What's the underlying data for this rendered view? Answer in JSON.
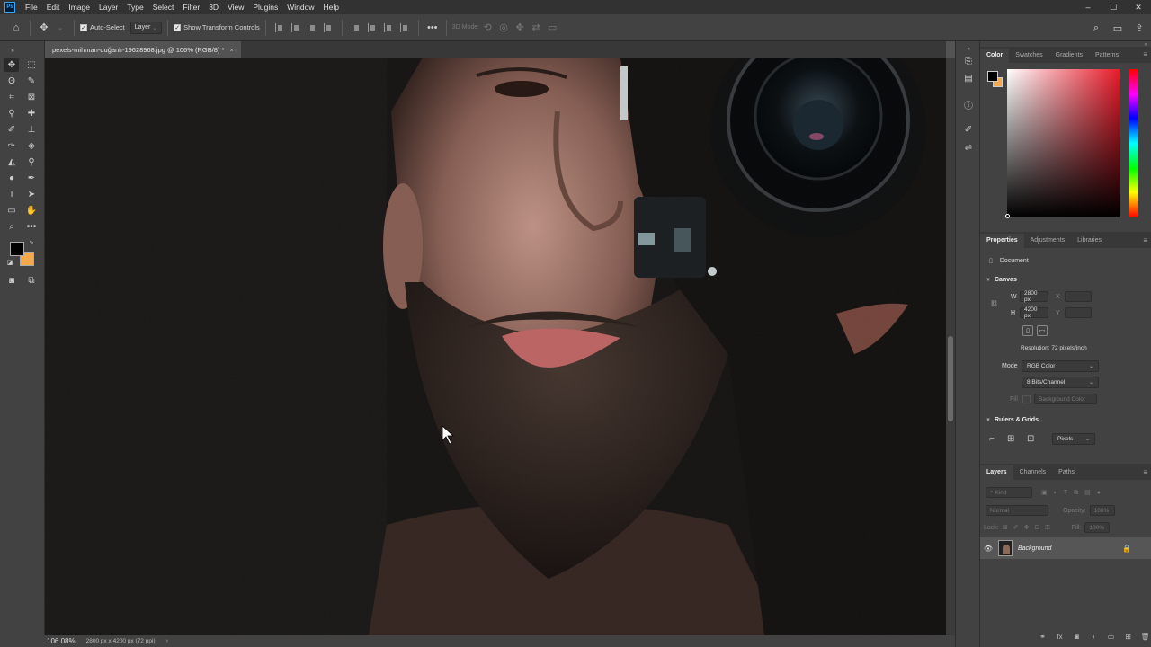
{
  "menu": {
    "logo": "Ps",
    "items": [
      "File",
      "Edit",
      "Image",
      "Layer",
      "Type",
      "Select",
      "Filter",
      "3D",
      "View",
      "Plugins",
      "Window",
      "Help"
    ]
  },
  "window_controls": {
    "minimize": "–",
    "maximize": "☐",
    "close": "✕"
  },
  "options": {
    "auto_select_label": "Auto-Select",
    "auto_select_target": "Layer",
    "show_transform_label": "Show Transform Controls",
    "mode_3d_label": "3D Mode:"
  },
  "document": {
    "tab_title": "pexels-mihman-duğanlı-19628968.jpg @ 106% (RGB/8) *",
    "close": "×"
  },
  "status": {
    "zoom": "106.08%",
    "dimensions": "2800 px x 4200 px (72 ppi)",
    "arrow": "›"
  },
  "color_panel": {
    "tabs": [
      "Color",
      "Swatches",
      "Gradients",
      "Patterns"
    ],
    "foreground": "#000000",
    "background": "#f5a94a"
  },
  "properties_panel": {
    "tabs": [
      "Properties",
      "Adjustments",
      "Libraries"
    ],
    "type_label": "Document",
    "canvas_section": "Canvas",
    "w_label": "W",
    "w_value": "2800 px",
    "h_label": "H",
    "h_value": "4200 px",
    "x_label": "X",
    "y_label": "Y",
    "resolution": "Resolution: 72 pixels/inch",
    "mode_label": "Mode",
    "mode_value": "RGB Color",
    "bits_value": "8 Bits/Channel",
    "fill_label": "Fill",
    "fill_value": "Background Color",
    "rulers_section": "Rulers & Grids",
    "units_value": "Pixels"
  },
  "layers_panel": {
    "tabs": [
      "Layers",
      "Channels",
      "Paths"
    ],
    "search_placeholder": "Kind",
    "blend_mode": "Normal",
    "opacity_label": "Opacity:",
    "opacity_value": "100%",
    "lock_label": "Lock:",
    "fill_label": "Fill:",
    "fill_value": "100%",
    "layers": [
      {
        "name": "Background",
        "visible": true,
        "locked": true
      }
    ]
  }
}
